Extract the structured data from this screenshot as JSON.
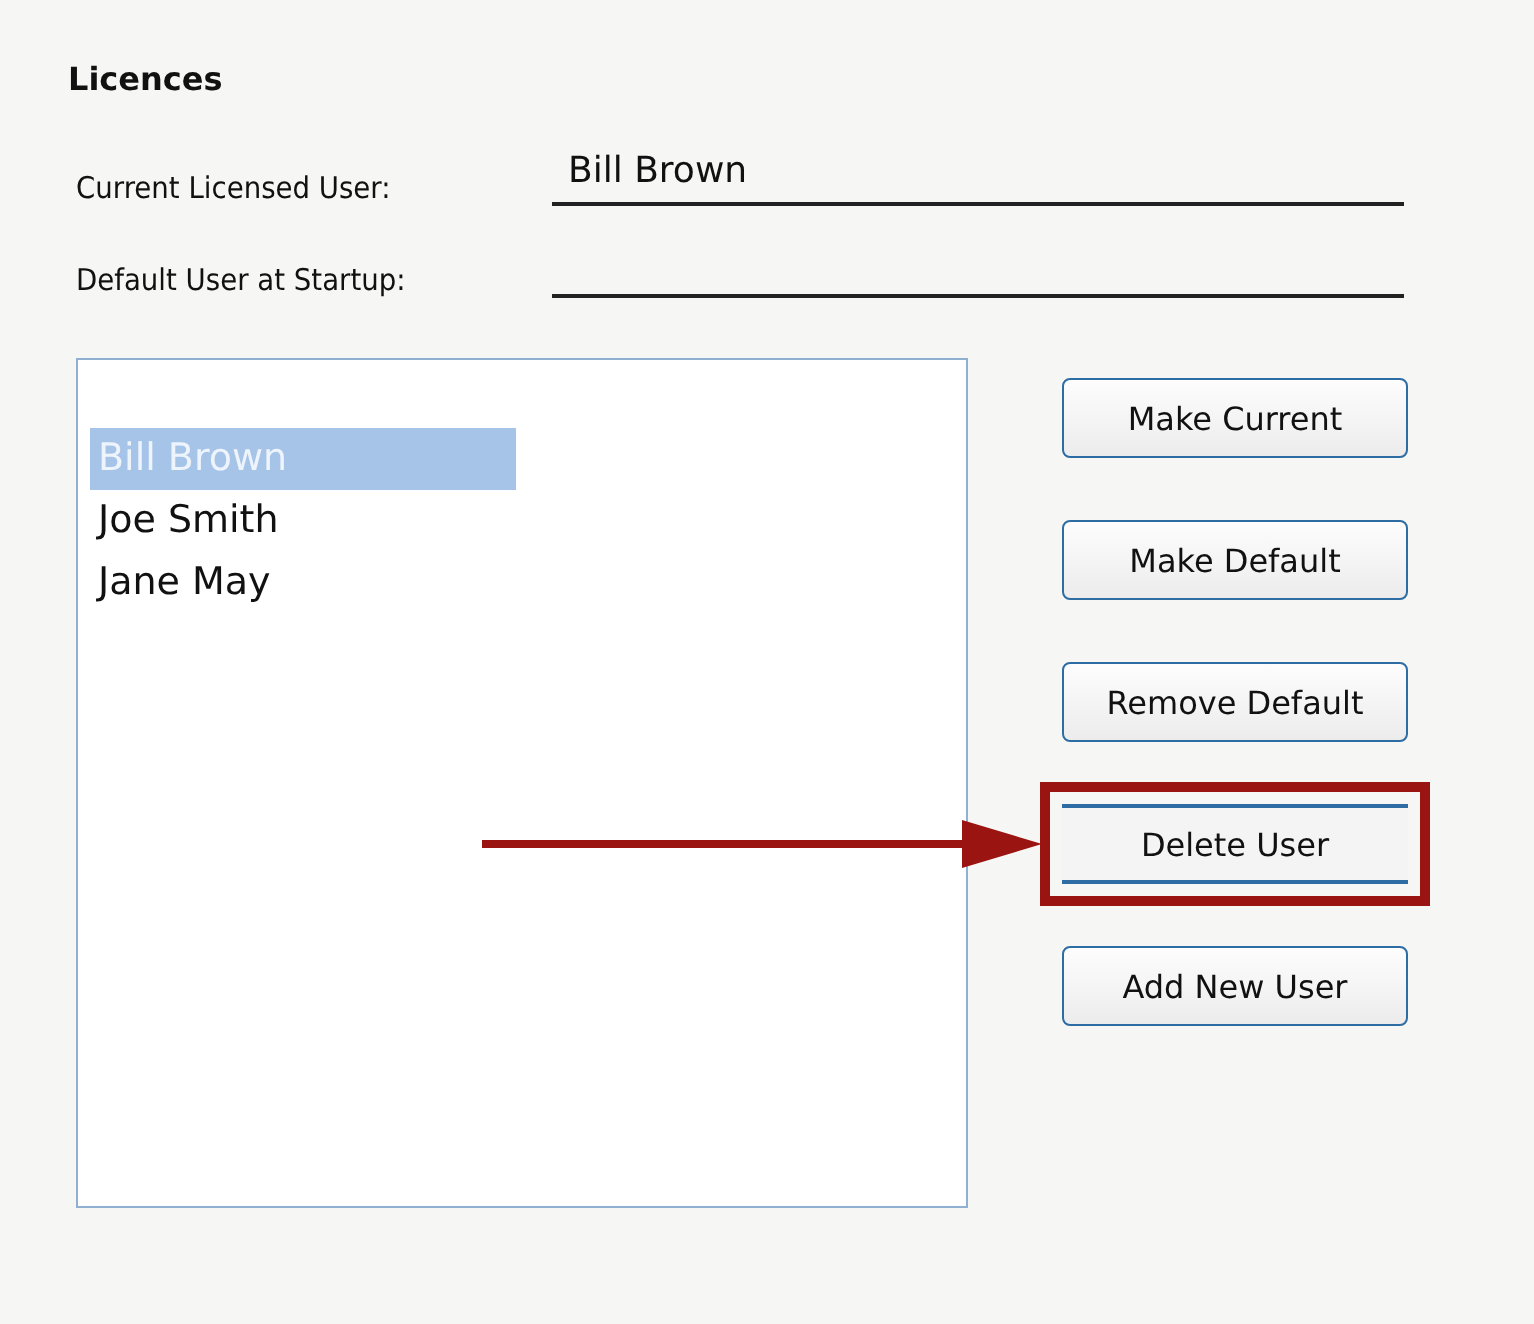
{
  "section": {
    "title": "Licences"
  },
  "fields": [
    {
      "label": "Current Licensed User:",
      "value": "Bill Brown"
    },
    {
      "label": "Default User at Startup:"
    }
  ],
  "users": [
    {
      "name": "Bill Brown",
      "selected": true
    },
    {
      "name": "Joe Smith",
      "selected": false
    },
    {
      "name": "Jane May",
      "selected": false
    }
  ],
  "buttons": [
    {
      "label": "Make Current",
      "highlighted": false
    },
    {
      "label": "Make Default",
      "highlighted": false
    },
    {
      "label": "Remove Default",
      "highlighted": false
    },
    {
      "label": "Delete User",
      "highlighted": true
    },
    {
      "label": "Add New User",
      "highlighted": false
    }
  ]
}
